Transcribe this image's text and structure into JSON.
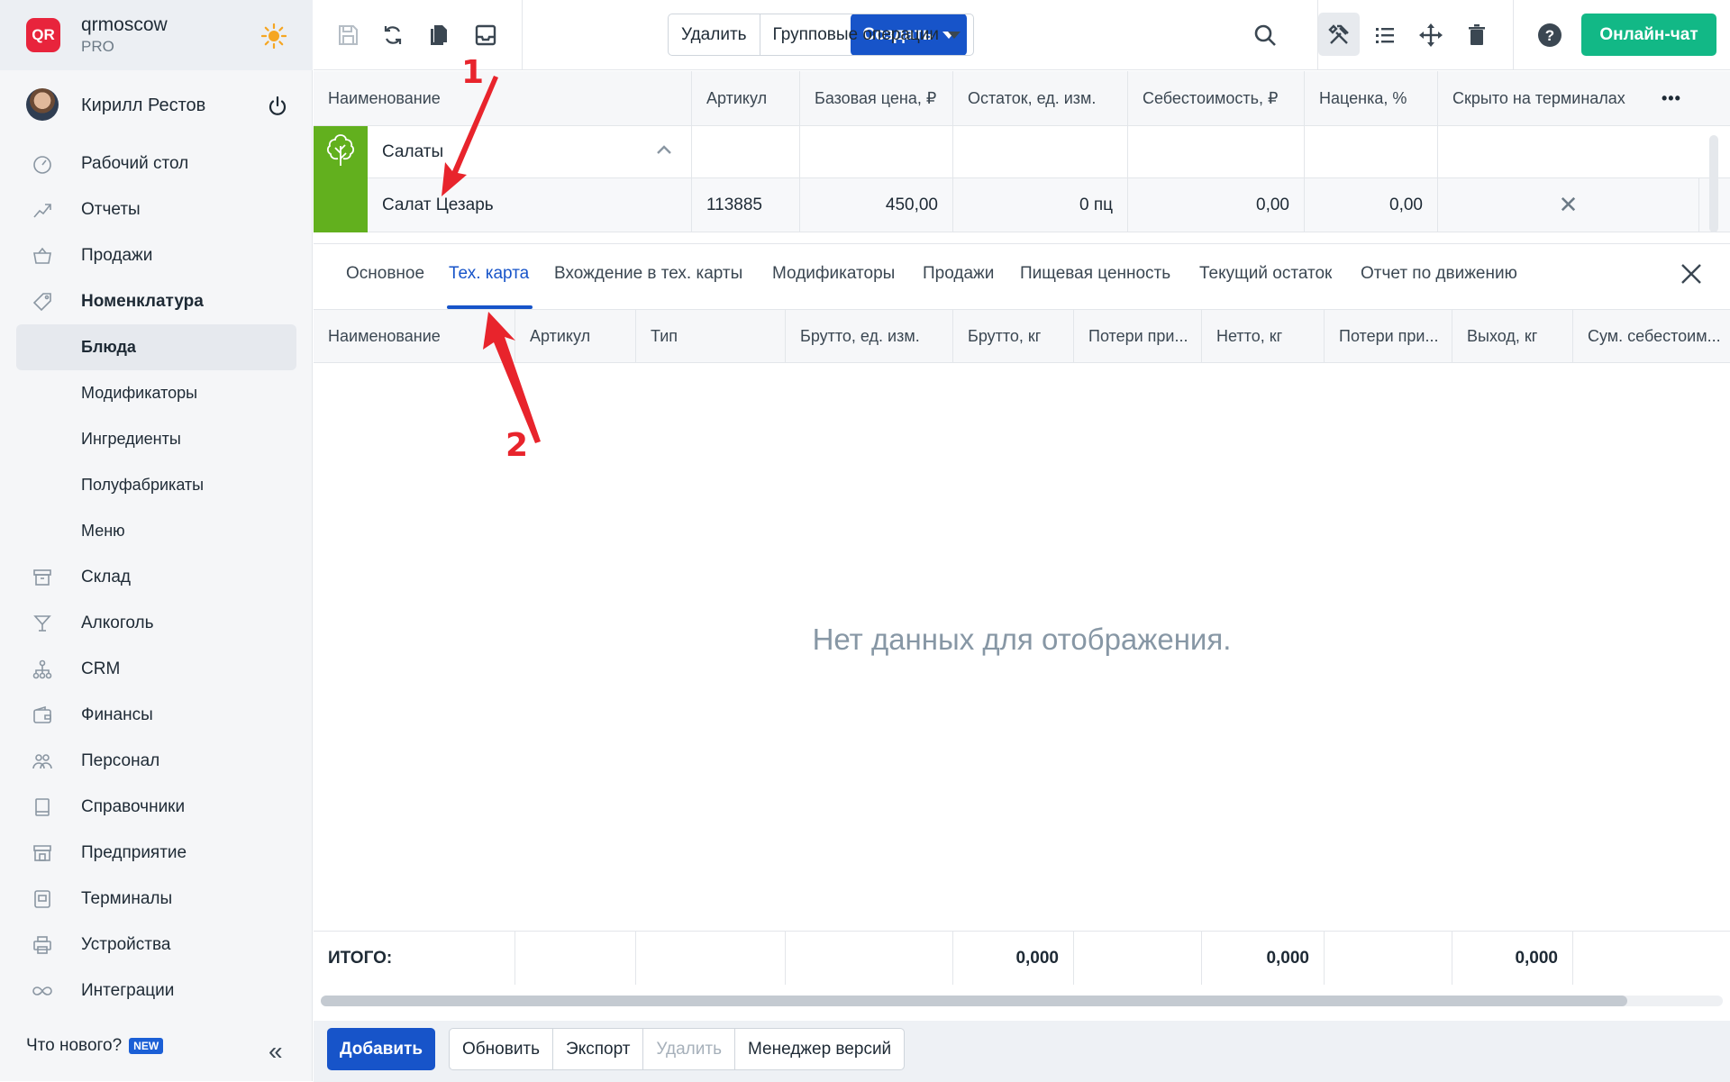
{
  "brand": {
    "name": "qrmoscow",
    "plan": "PRO",
    "logo_text": "QR"
  },
  "user": {
    "name": "Кирилл Рестов"
  },
  "sidebar": {
    "items": [
      {
        "label": "Рабочий стол",
        "icon": "dashboard-icon"
      },
      {
        "label": "Отчеты",
        "icon": "chart-icon"
      },
      {
        "label": "Продажи",
        "icon": "basket-icon"
      },
      {
        "label": "Номенклатура",
        "icon": "tag-icon"
      },
      {
        "label": "Блюда"
      },
      {
        "label": "Модификаторы"
      },
      {
        "label": "Ингредиенты"
      },
      {
        "label": "Полуфабрикаты"
      },
      {
        "label": "Меню"
      },
      {
        "label": "Склад",
        "icon": "box-icon"
      },
      {
        "label": "Алкоголь",
        "icon": "glass-icon"
      },
      {
        "label": "CRM",
        "icon": "network-icon"
      },
      {
        "label": "Финансы",
        "icon": "wallet-icon"
      },
      {
        "label": "Персонал",
        "icon": "people-icon"
      },
      {
        "label": "Справочники",
        "icon": "book-icon"
      },
      {
        "label": "Предприятие",
        "icon": "store-icon"
      },
      {
        "label": "Терминалы",
        "icon": "terminal-icon"
      },
      {
        "label": "Устройства",
        "icon": "printer-icon"
      },
      {
        "label": "Интеграции",
        "icon": "infinity-icon"
      }
    ],
    "whats_new": "Что нового?",
    "new_badge": "NEW",
    "collapse": "«"
  },
  "toolbar": {
    "create": "Создать",
    "delete": "Удалить",
    "group_ops": "Групповые операции",
    "chat": "Онлайн-чат"
  },
  "grid": {
    "columns": [
      "Наименование",
      "Артикул",
      "Базовая цена, ₽",
      "Остаток, ед. изм.",
      "Себестоимость, ₽",
      "Наценка, %",
      "Скрыто на терминалах"
    ],
    "more": "•••",
    "group": {
      "name": "Салаты"
    },
    "rows": [
      {
        "name": "Салат Цезарь",
        "sku": "113885",
        "price": "450,00",
        "stock": "0 пц",
        "cost": "0,00",
        "markup": "0,00",
        "hidden": "✕"
      }
    ]
  },
  "detail": {
    "tabs": [
      "Основное",
      "Тех. карта",
      "Вхождение в тех. карты",
      "Модификаторы",
      "Продажи",
      "Пищевая ценность",
      "Текущий остаток",
      "Отчет по движению"
    ],
    "active_tab": "Тех. карта",
    "columns": [
      "Наименование",
      "Артикул",
      "Тип",
      "Брутто, ед. изм.",
      "Брутто, кг",
      "Потери при...",
      "Нетто, кг",
      "Потери при...",
      "Выход, кг",
      "Сум. себестоим..."
    ],
    "empty": "Нет данных для отображения.",
    "total_label": "ИТОГО:",
    "totals": {
      "brutto_kg": "0,000",
      "netto_kg": "0,000",
      "yield_kg": "0,000"
    }
  },
  "bottom": {
    "add": "Добавить",
    "refresh": "Обновить",
    "export": "Экспорт",
    "delete": "Удалить",
    "versions": "Менеджер версий"
  },
  "annotations": {
    "one": "1",
    "two": "2"
  },
  "colors": {
    "accent": "#1754c9",
    "chat": "#12b886",
    "group": "#62b01e",
    "annotation": "#e8242c",
    "logo": "#e8243c"
  }
}
